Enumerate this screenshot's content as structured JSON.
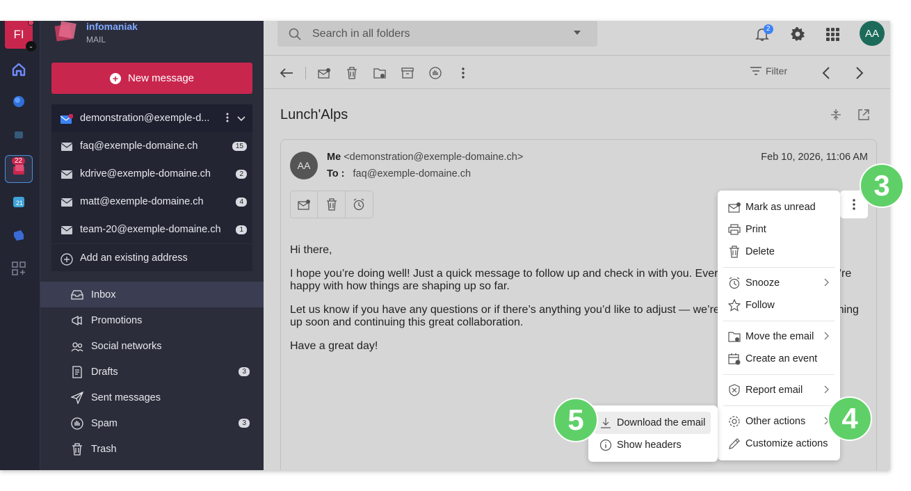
{
  "rail": {
    "user_initials": "FI",
    "mail_badge": "22"
  },
  "brand": {
    "name": "infomaniak",
    "sub": "MAIL"
  },
  "sidebar": {
    "new_message": "New message",
    "accounts": [
      {
        "label": "demonstration@exemple-d...",
        "count": ""
      },
      {
        "label": "faq@exemple-domaine.ch",
        "count": "15"
      },
      {
        "label": "kdrive@exemple-domaine.ch",
        "count": "2"
      },
      {
        "label": "matt@exemple-domaine.ch",
        "count": "4"
      },
      {
        "label": "team-20@exemple-domaine.ch",
        "count": "1"
      }
    ],
    "add_address": "Add an existing address",
    "folders": [
      {
        "label": "Inbox",
        "count": ""
      },
      {
        "label": "Promotions",
        "count": ""
      },
      {
        "label": "Social networks",
        "count": ""
      },
      {
        "label": "Drafts",
        "count": "3"
      },
      {
        "label": "Sent messages",
        "count": ""
      },
      {
        "label": "Spam",
        "count": "3"
      },
      {
        "label": "Trash",
        "count": ""
      }
    ]
  },
  "topbar": {
    "search_placeholder": "Search in all folders",
    "notification_count": "2",
    "avatar_initials": "AA"
  },
  "toolbar": {
    "filter_label": "Filter"
  },
  "message": {
    "subject": "Lunch'Alps",
    "avatar_initials": "AA",
    "from_name": "Me",
    "from_address": "<demonstration@exemple-domaine.ch>",
    "to_label": "To :",
    "to_address": "faq@exemple-domaine.ch",
    "date": "Feb 10, 2026, 11:06 AM",
    "body": [
      "Hi there,",
      "I hope you’re doing well! Just a quick message to follow up and check in with you. Ever                                    ing along nicely, and we’re happy with how things are shaping up so far.",
      "Let us know if you have any questions or if there’s anything you’d like to adjust — we’re Looking forward to catching up soon and continuing this great collaboration.",
      "Have a great day!"
    ]
  },
  "menu": {
    "items": [
      "Mark as unread",
      "Print",
      "Delete",
      "Snooze",
      "Follow",
      "Move the email",
      "Create an event",
      "Report email",
      "Other actions",
      "Customize actions"
    ]
  },
  "submenu": {
    "items": [
      "Download the email",
      "Show headers"
    ]
  },
  "callouts": [
    "3",
    "4",
    "5"
  ],
  "colors": {
    "brand_red": "#c9264e",
    "callout_green": "#5fd068",
    "sidebar_bg": "#2b2d3a",
    "main_bg": "#d6d6d6"
  }
}
